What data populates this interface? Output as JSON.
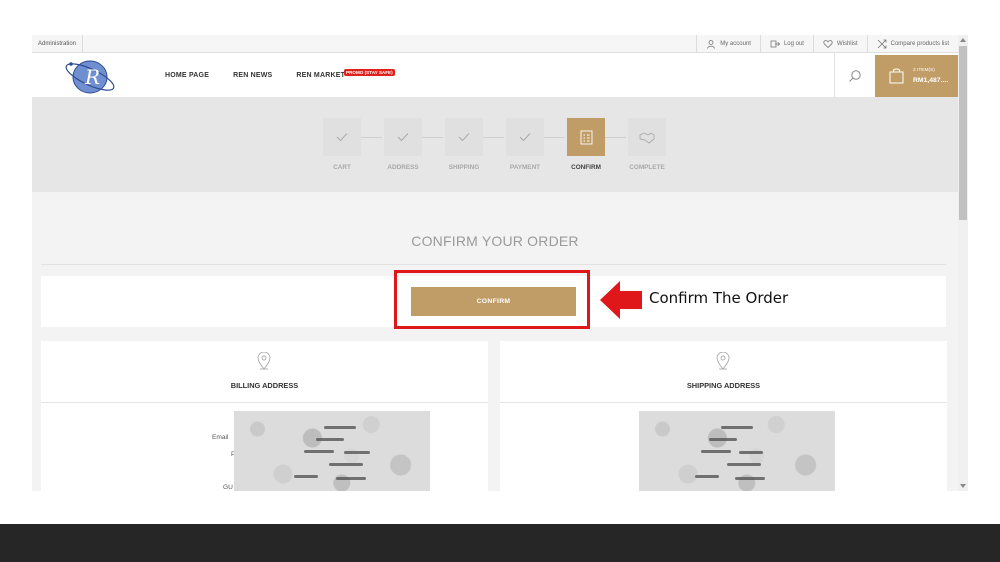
{
  "topbar": {
    "admin_label": "Administration",
    "links": [
      {
        "label": "My account",
        "icon": "user-icon"
      },
      {
        "label": "Log out",
        "icon": "logout-icon"
      },
      {
        "label": "Wishlist",
        "icon": "heart-icon"
      },
      {
        "label": "Compare products list",
        "icon": "compare-icon"
      }
    ]
  },
  "header": {
    "nav": [
      {
        "label": "HOME PAGE"
      },
      {
        "label": "REN NEWS"
      },
      {
        "label": "REN MARKET"
      }
    ],
    "promo_badge": "PROMO (STAY SAFE)",
    "cart": {
      "items": "2 ITEM(S)",
      "total": "RM1,487...."
    }
  },
  "steps": [
    {
      "label": "CART",
      "state": "done"
    },
    {
      "label": "ADDRESS",
      "state": "done"
    },
    {
      "label": "SHIPPING",
      "state": "done"
    },
    {
      "label": "PAYMENT",
      "state": "done"
    },
    {
      "label": "CONFIRM",
      "state": "active"
    },
    {
      "label": "COMPLETE",
      "state": "pending"
    }
  ],
  "page_title": "CONFIRM YOUR ORDER",
  "confirm_button": "CONFIRM",
  "annotation": "Confirm The Order",
  "billing": {
    "title": "BILLING ADDRESS",
    "field_labels": [
      "Email",
      "P",
      "GU"
    ]
  },
  "shipping": {
    "title": "SHIPPING ADDRESS"
  },
  "colors": {
    "accent": "#c09d66",
    "highlight": "#e0171a",
    "promo": "#e0201d"
  }
}
